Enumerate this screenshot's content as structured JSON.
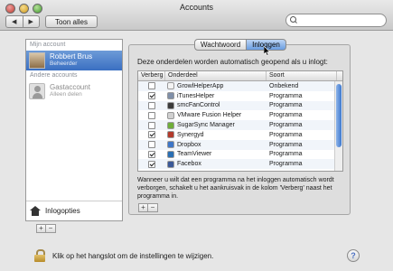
{
  "window": {
    "title": "Accounts"
  },
  "toolbar": {
    "back_glyph": "◀",
    "forward_glyph": "▶",
    "show_all": "Toon alles",
    "search": {
      "value": "",
      "placeholder": ""
    }
  },
  "accounts": {
    "my_account_header": "Mijn account",
    "my_account": {
      "name": "Robbert Brus",
      "role": "Beheerder"
    },
    "other_header": "Andere accounts",
    "others": [
      {
        "name": "Gastaccount",
        "role": "Alleen delen"
      }
    ],
    "login_options": "Inlogopties",
    "add": "+",
    "remove": "−"
  },
  "tabs": {
    "items": [
      "Wachtwoord",
      "Inloggen"
    ],
    "active": "Inloggen"
  },
  "login_items": {
    "description": "Deze onderdelen worden automatisch geopend als u inlogt:",
    "columns": {
      "hide": "Verberg",
      "item": "Onderdeel",
      "kind": "Soort"
    },
    "rows": [
      {
        "hide": false,
        "name": "GrowlHelperApp",
        "kind": "Onbekend",
        "icon_color": "#f4f4f4"
      },
      {
        "hide": true,
        "name": "iTunesHelper",
        "kind": "Programma",
        "icon_color": "#7f8fa8"
      },
      {
        "hide": false,
        "name": "smcFanControl",
        "kind": "Programma",
        "icon_color": "#3b3b3b"
      },
      {
        "hide": false,
        "name": "VMware Fusion Helper",
        "kind": "Programma",
        "icon_color": "#d0d0d0"
      },
      {
        "hide": false,
        "name": "SugarSync Manager",
        "kind": "Programma",
        "icon_color": "#6fae3a"
      },
      {
        "hide": true,
        "name": "Synergyd",
        "kind": "Programma",
        "icon_color": "#b33a2b"
      },
      {
        "hide": false,
        "name": "Dropbox",
        "kind": "Programma",
        "icon_color": "#3d76c7"
      },
      {
        "hide": true,
        "name": "TeamViewer",
        "kind": "Programma",
        "icon_color": "#2a6fb4"
      },
      {
        "hide": true,
        "name": "Facebox",
        "kind": "Programma",
        "icon_color": "#3b5998"
      }
    ],
    "note": "Wanneer u wilt dat een programma na het inloggen automatisch wordt verborgen, schakelt u het aankruisvak in de kolom 'Verberg' naast het programma in.",
    "add": "+",
    "remove": "−"
  },
  "footer": {
    "lock_text": "Klik op het hangslot om de instellingen te wijzigen.",
    "help": "?"
  }
}
